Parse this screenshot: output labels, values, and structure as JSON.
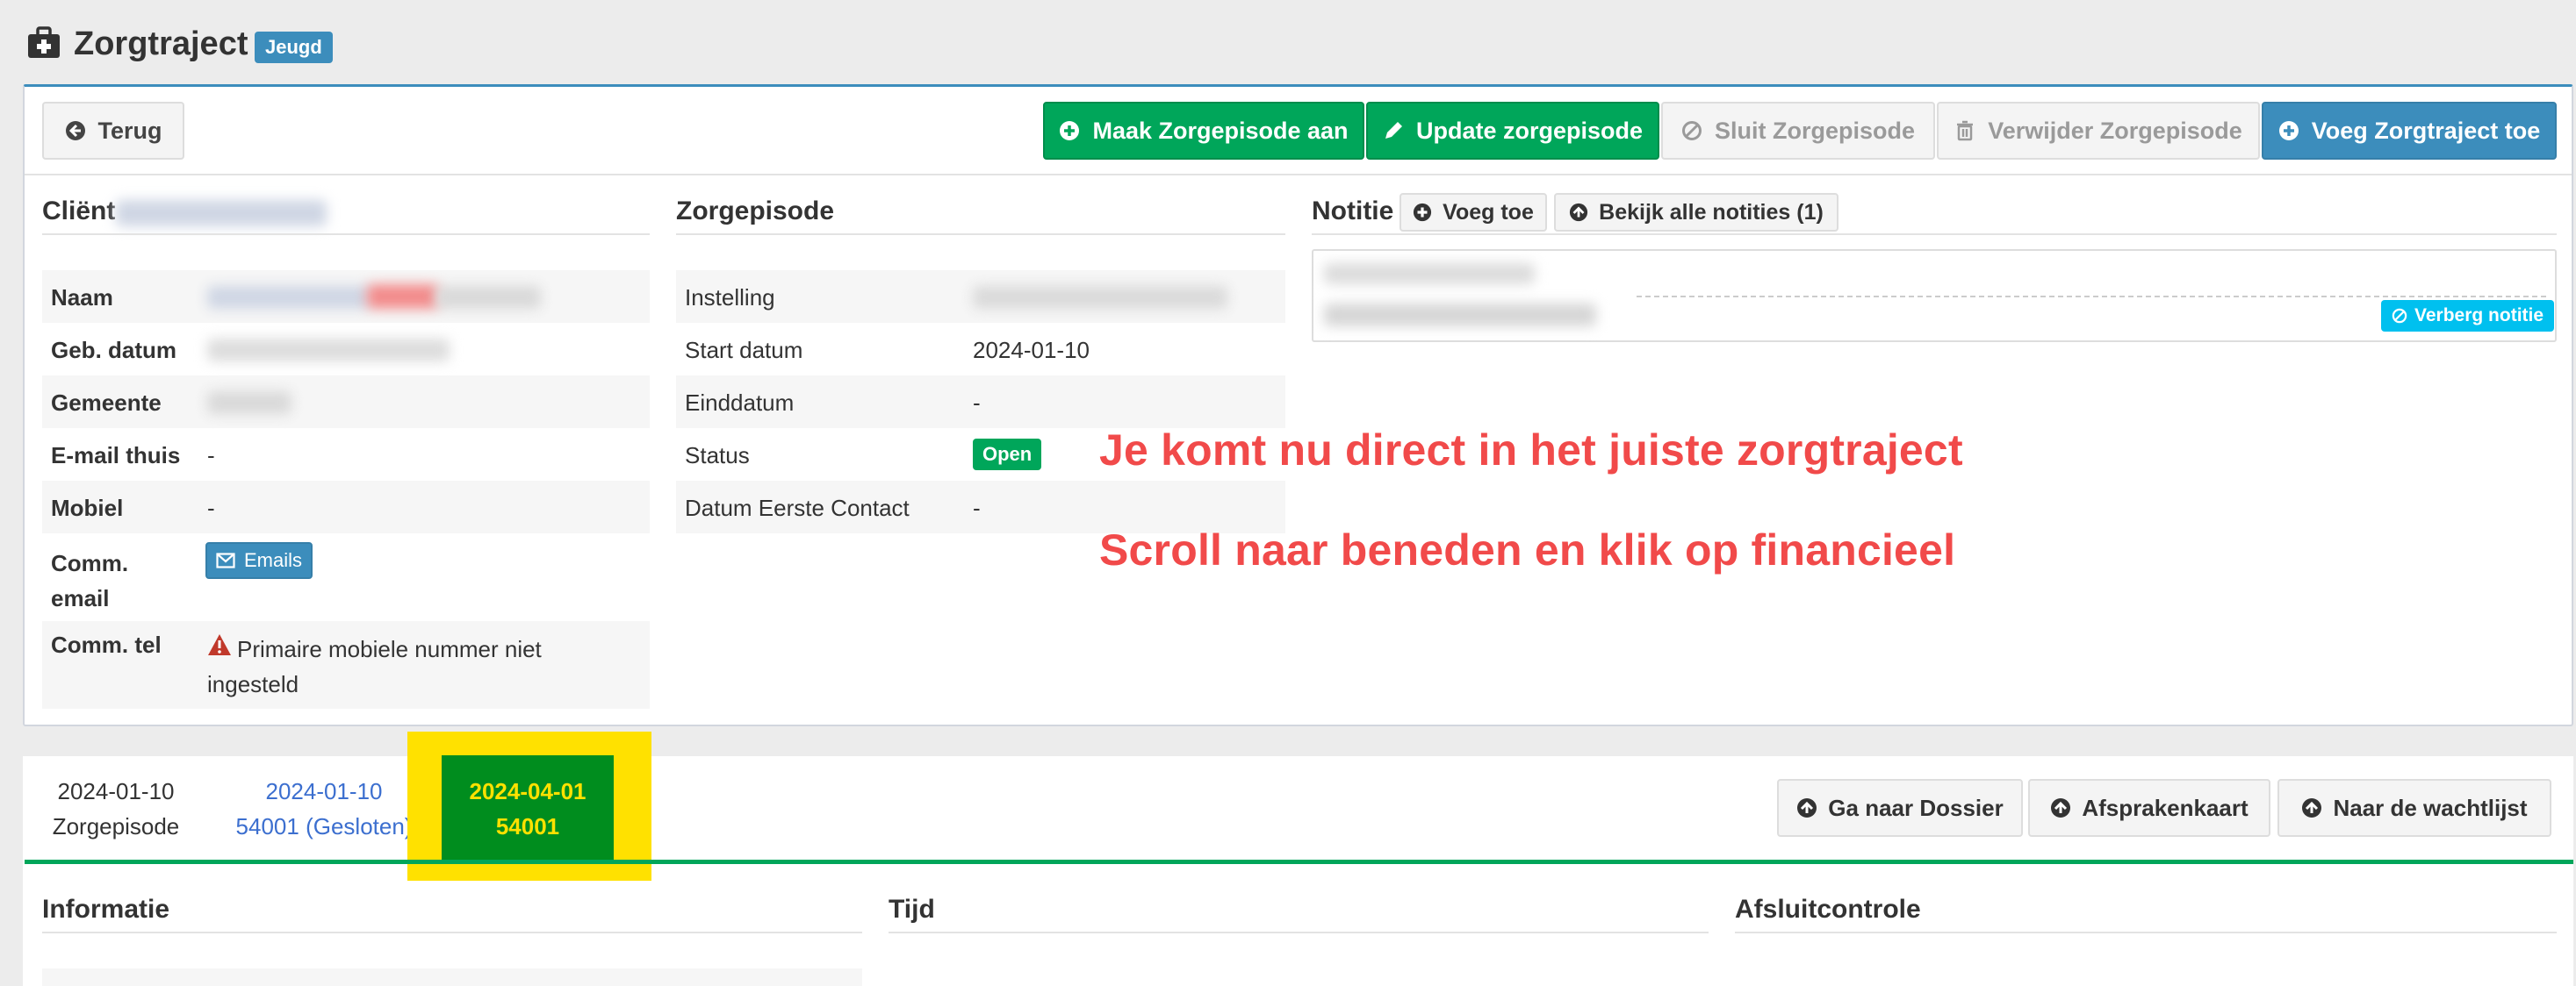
{
  "header": {
    "title": "Zorgtraject",
    "badge": "Jeugd"
  },
  "toolbar": {
    "back": "Terug",
    "create_episode": "Maak Zorgepisode aan",
    "update_episode": "Update zorgepisode",
    "close_episode": "Sluit Zorgepisode",
    "delete_episode": "Verwijder Zorgepisode",
    "add_trajectory": "Voeg Zorgtraject toe"
  },
  "client": {
    "heading": "Cliënt",
    "rows": [
      {
        "label": "Naam"
      },
      {
        "label": "Geb. datum"
      },
      {
        "label": "Gemeente"
      },
      {
        "label": "E-mail thuis",
        "value": "-"
      },
      {
        "label": "Mobiel",
        "value": "-"
      },
      {
        "label": "Comm. email",
        "value": "Emails"
      },
      {
        "label": "Comm. tel",
        "value": "Primaire mobiele nummer niet ingesteld"
      }
    ]
  },
  "episode": {
    "heading": "Zorgepisode",
    "rows": [
      {
        "label": "Instelling"
      },
      {
        "label": "Start datum",
        "value": "2024-01-10"
      },
      {
        "label": "Einddatum",
        "value": "-"
      },
      {
        "label": "Status",
        "value": "Open"
      },
      {
        "label": "Datum Eerste Contact",
        "value": "-"
      }
    ]
  },
  "notes": {
    "heading": "Notitie",
    "add": "Voeg toe",
    "view_all": "Bekijk alle notities (1)",
    "hide": "Verberg notitie"
  },
  "overlay": {
    "line1": "Je komt nu direct in het juiste zorgtraject",
    "line2": "Scroll naar beneden en klik op financieel"
  },
  "episodes_bar": {
    "first": {
      "date": "2024-01-10",
      "label": "Zorgepisode"
    },
    "second": {
      "date": "2024-01-10",
      "label": "54001 (Gesloten)"
    },
    "active": {
      "date": "2024-04-01",
      "label": "54001"
    },
    "buttons": {
      "dossier": "Ga naar Dossier",
      "agenda": "Afsprakenkaart",
      "waitlist": "Naar de wachtlijst"
    }
  },
  "sections": {
    "info": "Informatie",
    "time": "Tijd",
    "closing": "Afsluitcontrole"
  },
  "colors": {
    "primary": "#3c8dbc",
    "success": "#00a65a",
    "highlight": "#ffe100",
    "annotation": "#f14a4a",
    "info": "#00c0ef"
  }
}
